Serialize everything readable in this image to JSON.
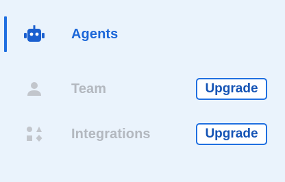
{
  "sidebar": {
    "items": [
      {
        "label": "Agents",
        "icon": "robot-icon",
        "state": "active"
      },
      {
        "label": "Team",
        "icon": "user-icon",
        "state": "disabled",
        "badge": "Upgrade"
      },
      {
        "label": "Integrations",
        "icon": "shapes-icon",
        "state": "disabled",
        "badge": "Upgrade"
      }
    ]
  },
  "colors": {
    "accent": "#1f6fe0",
    "active_text": "#1b66d8",
    "disabled_text": "#b3b8bf",
    "background": "#eaf3fc"
  }
}
